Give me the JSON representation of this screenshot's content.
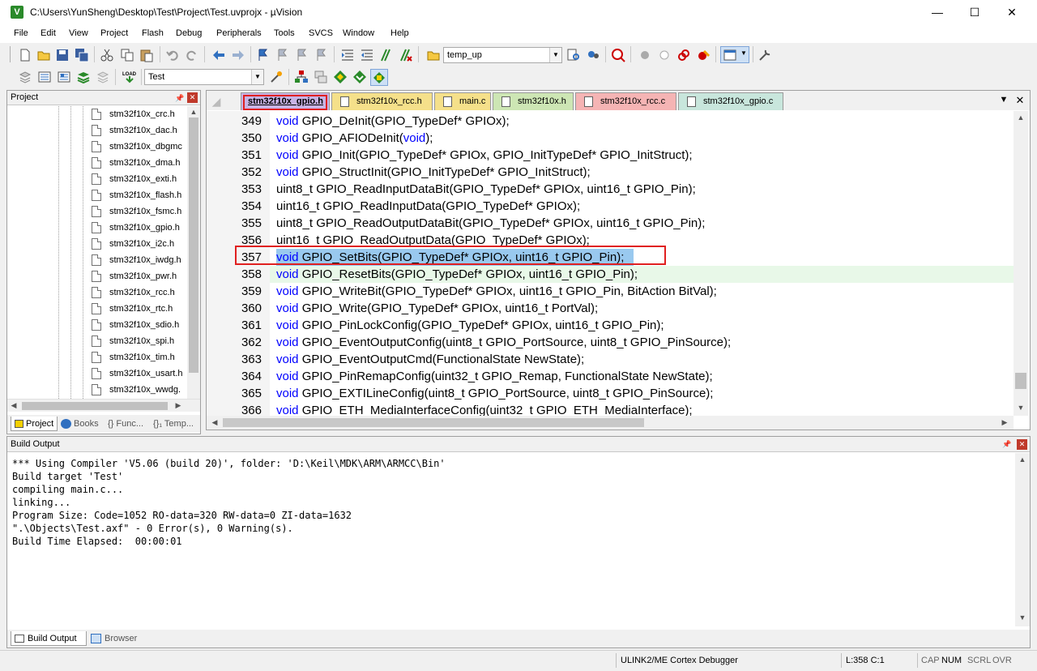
{
  "window": {
    "title": "C:\\Users\\YunSheng\\Desktop\\Test\\Project\\Test.uvprojx - µVision",
    "icon_letter": "V",
    "minimize": "—",
    "maximize": "☐",
    "close": "✕"
  },
  "menu": [
    "File",
    "Edit",
    "View",
    "Project",
    "Flash",
    "Debug",
    "Peripherals",
    "Tools",
    "SVCS",
    "Window",
    "Help"
  ],
  "toolbar": {
    "find_combo": "temp_up",
    "target_combo": "Test"
  },
  "project_panel": {
    "title": "Project",
    "files": [
      "stm32f10x_crc.h",
      "stm32f10x_dac.h",
      "stm32f10x_dbgmc",
      "stm32f10x_dma.h",
      "stm32f10x_exti.h",
      "stm32f10x_flash.h",
      "stm32f10x_fsmc.h",
      "stm32f10x_gpio.h",
      "stm32f10x_i2c.h",
      "stm32f10x_iwdg.h",
      "stm32f10x_pwr.h",
      "stm32f10x_rcc.h",
      "stm32f10x_rtc.h",
      "stm32f10x_sdio.h",
      "stm32f10x_spi.h",
      "stm32f10x_tim.h",
      "stm32f10x_usart.h",
      "stm32f10x_wwdg."
    ],
    "tabs": [
      "Project",
      "Books",
      "{} Func...",
      "{}₁ Temp..."
    ]
  },
  "editor": {
    "tabs": [
      {
        "label": "stm32f10x_gpio.h",
        "color": "#c8b4e6",
        "active": true
      },
      {
        "label": "stm32f10x_rcc.h",
        "color": "#f5e08a",
        "active": false
      },
      {
        "label": "main.c",
        "color": "#f5e08a",
        "active": false
      },
      {
        "label": "stm32f10x.h",
        "color": "#cde6b4",
        "active": false
      },
      {
        "label": "stm32f10x_rcc.c",
        "color": "#f5b4b4",
        "active": false
      },
      {
        "label": "stm32f10x_gpio.c",
        "color": "#c8e6dc",
        "active": false
      }
    ],
    "lines": [
      {
        "num": "349",
        "kw": "void",
        "text": " GPIO_DeInit(GPIO_TypeDef* GPIOx);"
      },
      {
        "num": "350",
        "kw": "void",
        "text": " GPIO_AFIODeInit(",
        "kw2": "void",
        "tail": ");"
      },
      {
        "num": "351",
        "kw": "void",
        "text": " GPIO_Init(GPIO_TypeDef* GPIOx, GPIO_InitTypeDef* GPIO_InitStruct);"
      },
      {
        "num": "352",
        "kw": "void",
        "text": " GPIO_StructInit(GPIO_InitTypeDef* GPIO_InitStruct);"
      },
      {
        "num": "353",
        "kw": "",
        "text": "uint8_t GPIO_ReadInputDataBit(GPIO_TypeDef* GPIOx, uint16_t GPIO_Pin);"
      },
      {
        "num": "354",
        "kw": "",
        "text": "uint16_t GPIO_ReadInputData(GPIO_TypeDef* GPIOx);"
      },
      {
        "num": "355",
        "kw": "",
        "text": "uint8_t GPIO_ReadOutputDataBit(GPIO_TypeDef* GPIOx, uint16_t GPIO_Pin);"
      },
      {
        "num": "356",
        "kw": "",
        "text": "uint16_t GPIO_ReadOutputData(GPIO_TypeDef* GPIOx);"
      },
      {
        "num": "357",
        "kw": "void",
        "text": " GPIO_SetBits(GPIO_TypeDef* GPIOx, uint16_t GPIO_Pin);",
        "selected": true
      },
      {
        "num": "358",
        "kw": "void",
        "text": " GPIO_ResetBits(GPIO_TypeDef* GPIOx, uint16_t GPIO_Pin);",
        "current": true
      },
      {
        "num": "359",
        "kw": "void",
        "text": " GPIO_WriteBit(GPIO_TypeDef* GPIOx, uint16_t GPIO_Pin, BitAction BitVal);"
      },
      {
        "num": "360",
        "kw": "void",
        "text": " GPIO_Write(GPIO_TypeDef* GPIOx, uint16_t PortVal);"
      },
      {
        "num": "361",
        "kw": "void",
        "text": " GPIO_PinLockConfig(GPIO_TypeDef* GPIOx, uint16_t GPIO_Pin);"
      },
      {
        "num": "362",
        "kw": "void",
        "text": " GPIO_EventOutputConfig(uint8_t GPIO_PortSource, uint8_t GPIO_PinSource);"
      },
      {
        "num": "363",
        "kw": "void",
        "text": " GPIO_EventOutputCmd(FunctionalState NewState);"
      },
      {
        "num": "364",
        "kw": "void",
        "text": " GPIO_PinRemapConfig(uint32_t GPIO_Remap, FunctionalState NewState);"
      },
      {
        "num": "365",
        "kw": "void",
        "text": " GPIO_EXTILineConfig(uint8_t GPIO_PortSource, uint8_t GPIO_PinSource);"
      },
      {
        "num": "366",
        "kw": "void",
        "text": " GPIO_ETH_MediaInterfaceConfig(uint32_t GPIO_ETH_MediaInterface);"
      }
    ],
    "selection_color": "#99c9ef",
    "current_line_color": "#e8f8e8",
    "keyword_color": "#0000ff",
    "highlight_box_color": "#e02020"
  },
  "build_output": {
    "title": "Build Output",
    "lines": [
      "*** Using Compiler 'V5.06 (build 20)', folder: 'D:\\Keil\\MDK\\ARM\\ARMCC\\Bin'",
      "Build target 'Test'",
      "compiling main.c...",
      "linking...",
      "Program Size: Code=1052 RO-data=320 RW-data=0 ZI-data=1632",
      "\".\\Objects\\Test.axf\" - 0 Error(s), 0 Warning(s).",
      "Build Time Elapsed:  00:00:01"
    ],
    "tabs": [
      "Build Output",
      "Browser"
    ]
  },
  "statusbar": {
    "debugger": "ULINK2/ME Cortex Debugger",
    "position": "L:358 C:1",
    "caps": "CAP",
    "num": "NUM",
    "scrl": "SCRL",
    "ovr": "OVR"
  }
}
